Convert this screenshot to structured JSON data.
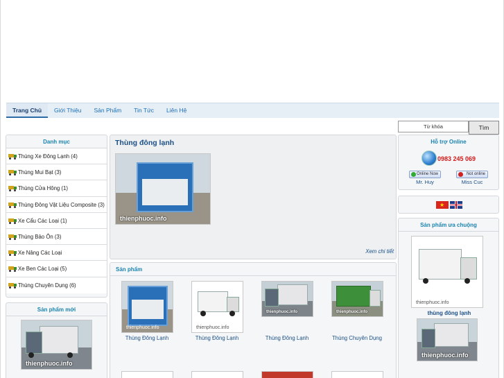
{
  "nav": {
    "items": [
      "Trang Chủ",
      "Giới Thiệu",
      "Sản Phẩm",
      "Tin Tức",
      "Liên Hệ"
    ],
    "active": "Trang Chủ"
  },
  "sidebar": {
    "category_title": "Danh mục",
    "categories": [
      "Thùng Xe Đông Lạnh (4)",
      "Thùng Mui Bạt (3)",
      "Thùng Cửa Hông (1)",
      "Thùng Đông Vật Liệu Composite (3)",
      "Xe Cẩu Các Loại (1)",
      "Thùng Bảo Ôn (3)",
      "Xe Nâng Các Loại",
      "Xe Ben Các Loại (5)",
      "Thùng Chuyên Dụng (6)"
    ],
    "new_products_title": "Sản phẩm mới",
    "new_product_watermark": "thienphuoc.info"
  },
  "featured": {
    "title": "Thùng đông lạnh",
    "watermark": "thienphuoc.info",
    "more_link": "Xem chi tiết"
  },
  "products": {
    "title": "Sản phẩm",
    "items": [
      {
        "name": "Thùng Đông Lạnh",
        "watermark": "thienphuoc.info"
      },
      {
        "name": "Thùng Đông Lạnh",
        "watermark": "thienphuoc.info"
      },
      {
        "name": "Thùng Đông Lạnh",
        "watermark": "thienphuoc.info"
      },
      {
        "name": "Thùng Chuyên Dụng",
        "watermark": "thienphuoc.info"
      }
    ]
  },
  "search": {
    "placeholder": "Từ khóa",
    "button": "Tìm"
  },
  "support": {
    "title": "Hỗ trợ Online",
    "phone": "0983 245 069",
    "agents": [
      {
        "status": "Online Now",
        "name": "Mr. Huy",
        "status_color": "#33aa33"
      },
      {
        "status": "Not online",
        "name": "Miss Cuc",
        "status_color": "#cc2222"
      }
    ]
  },
  "languages": [
    "vietnamese-flag-icon",
    "english-flag-icon"
  ],
  "favorites": {
    "title": "Sản phẩm ưa chuộng",
    "items": [
      {
        "name": "thùng đông lạnh",
        "watermark": "thienphuoc.info"
      },
      {
        "name": "",
        "watermark": "thienphuoc.info"
      }
    ]
  },
  "colors": {
    "accent": "#1b84b0",
    "link": "#1b4f87",
    "phone": "#d11a1a",
    "nav_bg": "#e6eef6"
  }
}
